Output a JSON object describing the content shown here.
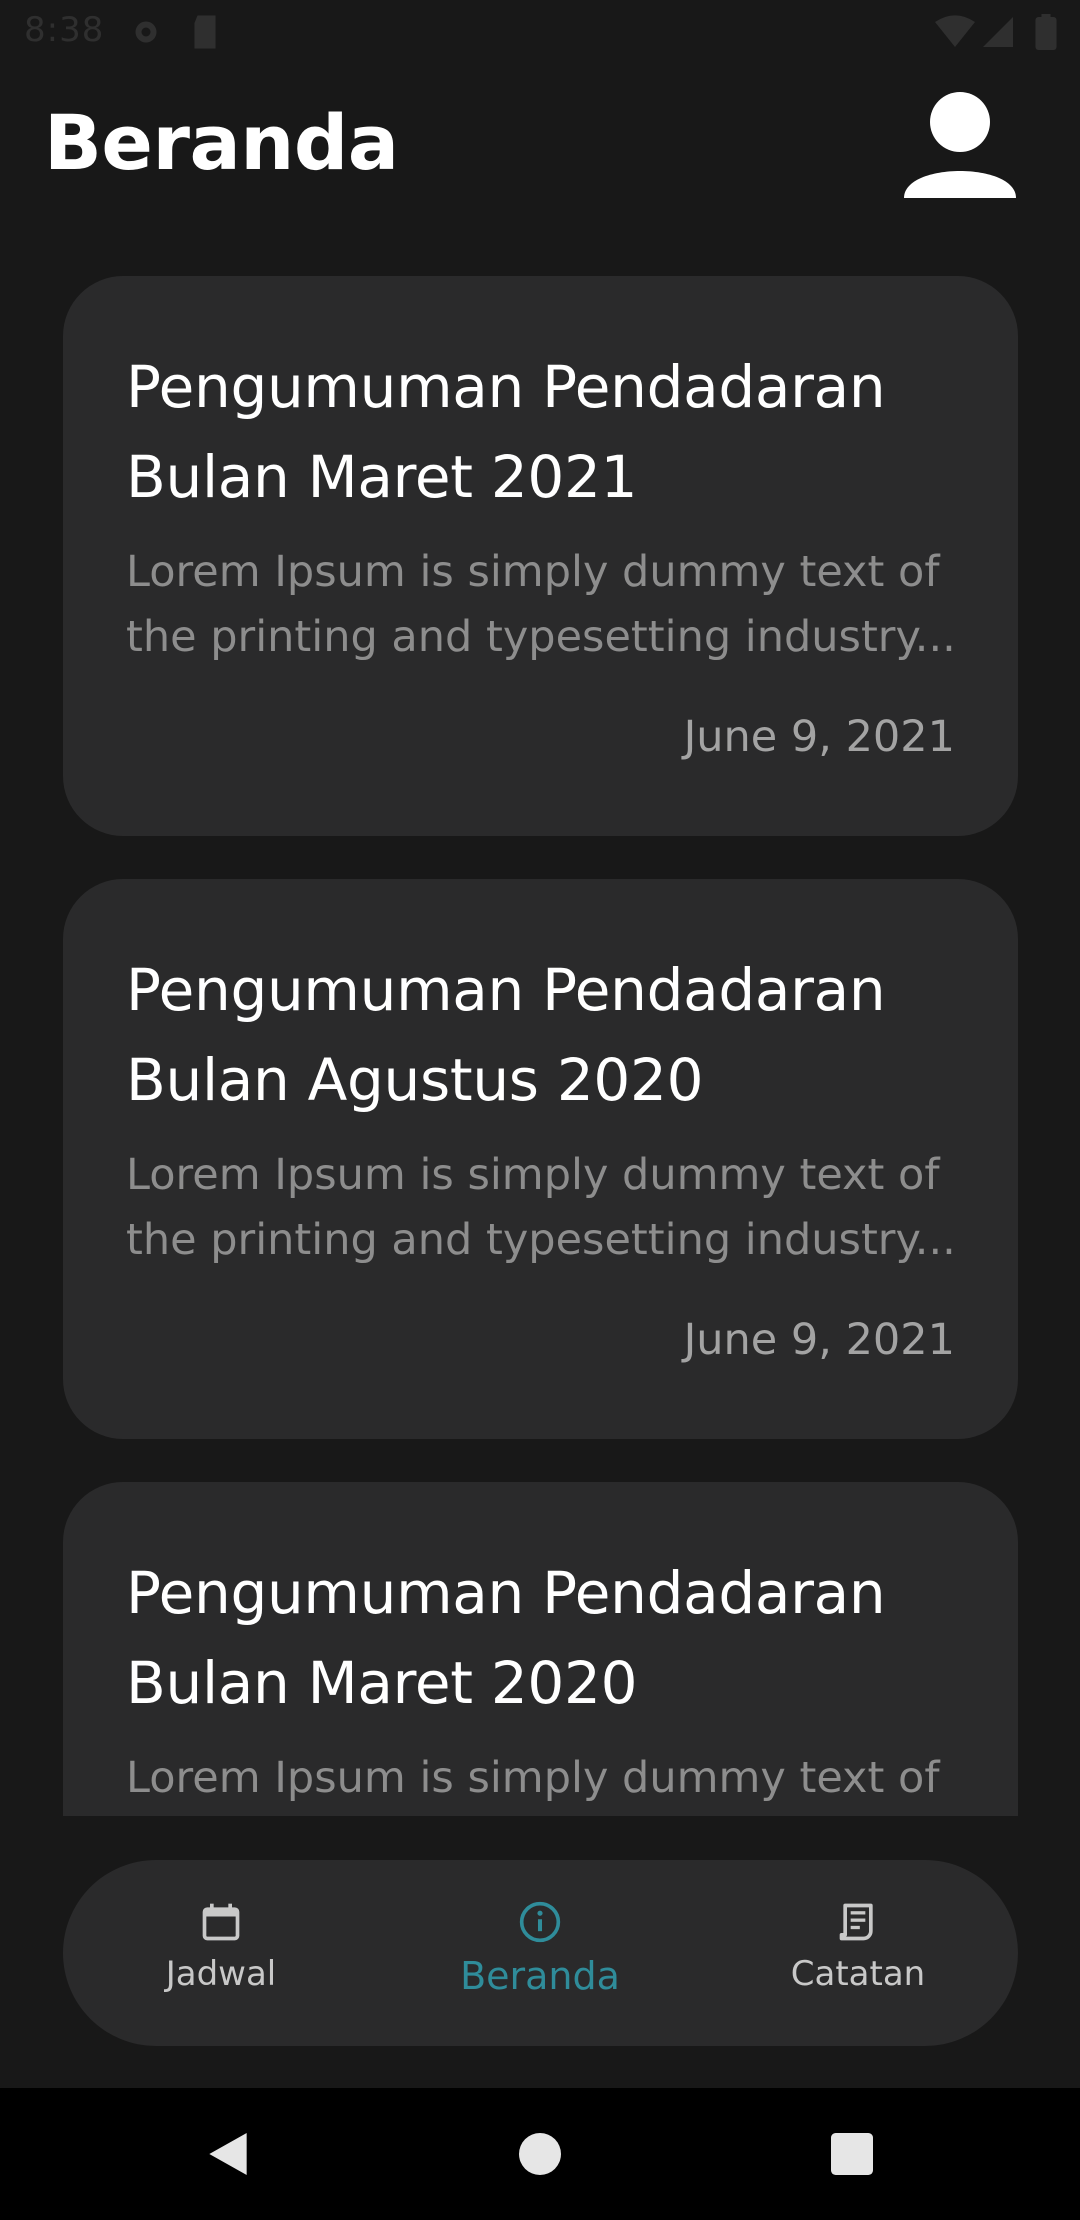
{
  "status_bar": {
    "time": "8:38"
  },
  "header": {
    "title": "Beranda",
    "profile_icon": "person-icon"
  },
  "announcements": [
    {
      "title": "Pengumuman Pendadaran\nBulan Maret 2021",
      "excerpt": "Lorem Ipsum is simply dummy text of\nthe printing and typesetting industry...",
      "date": "June 9, 2021"
    },
    {
      "title": "Pengumuman Pendadaran\nBulan Agustus 2020",
      "excerpt": "Lorem Ipsum is simply dummy text of\nthe printing and typesetting industry...",
      "date": "June 9, 2021"
    },
    {
      "title": "Pengumuman Pendadaran\nBulan Maret 2020",
      "excerpt": "Lorem Ipsum is simply dummy text of",
      "date": ""
    }
  ],
  "bottom_nav": {
    "items": [
      {
        "label": "Jadwal",
        "icon": "calendar-icon",
        "active": false
      },
      {
        "label": "Beranda",
        "icon": "info-icon",
        "active": true
      },
      {
        "label": "Catatan",
        "icon": "receipt-icon",
        "active": false
      }
    ]
  },
  "colors": {
    "background": "#181818",
    "card": "#2a2a2b",
    "accent": "#2f8c9a",
    "title_text": "#ffffff",
    "body_text": "#8d8d8d"
  }
}
